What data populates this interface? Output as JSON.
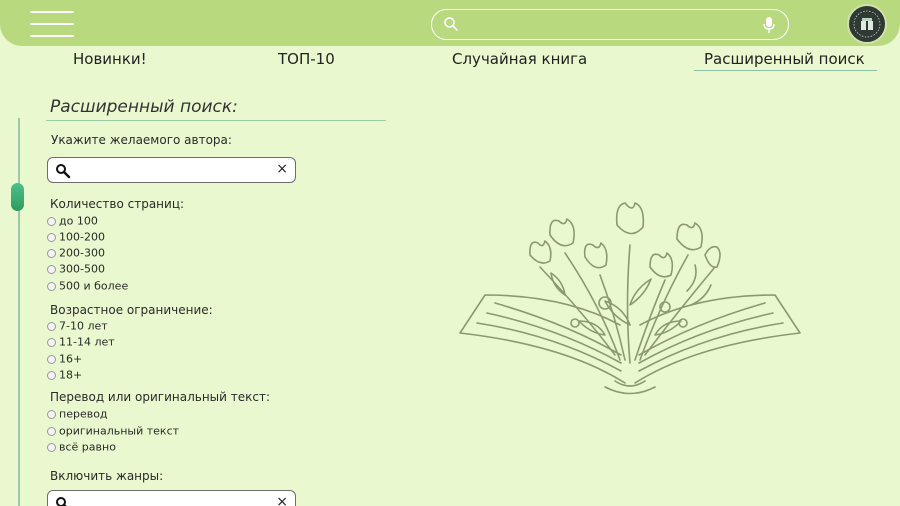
{
  "header": {
    "search_placeholder": "",
    "icons": [
      "menu-icon",
      "search-icon",
      "microphone-icon",
      "user-avatar"
    ]
  },
  "nav": {
    "items": [
      "Новинки!",
      "ТОП-10",
      "Случайная книга",
      "Расширенный поиск"
    ],
    "active": "Расширенный поиск"
  },
  "panel": {
    "title": "Расширенный поиск:",
    "author_label": "Укажите желаемого автора:",
    "pages_label": "Количество страниц:",
    "pages_options": [
      "до 100",
      "100-200",
      "200-300",
      "300-500",
      "500 и более"
    ],
    "age_label": "Возрастное ограничение:",
    "age_options": [
      "7-10 лет",
      "11-14 лет",
      "16+",
      "18+"
    ],
    "translation_label": "Перевод или оригинальный текст:",
    "translation_options": [
      "перевод",
      "оригинальный текст",
      "всё равно"
    ],
    "genres_label": "Включить жанры:",
    "clear_symbol": "×"
  },
  "colors": {
    "background": "#eaf8cf",
    "header": "#b9d97f",
    "accent": "#9cc9a6",
    "illustration": "#8a9a6e"
  }
}
